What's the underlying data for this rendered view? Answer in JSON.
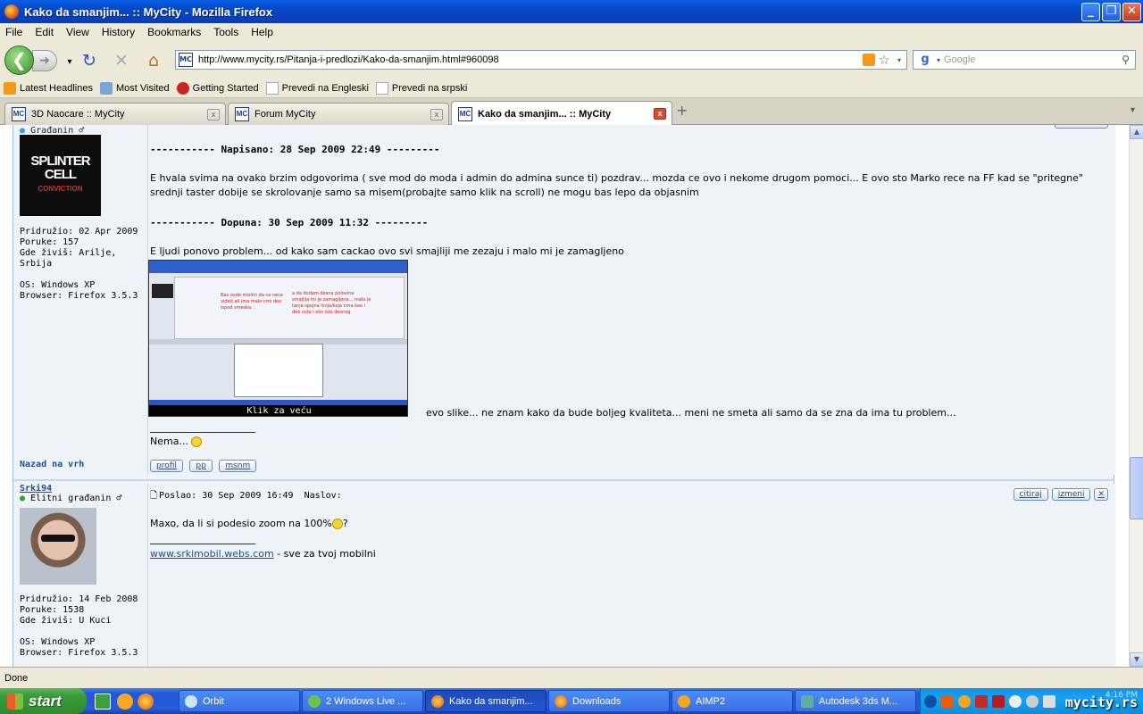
{
  "window": {
    "title": "Kako da smanjim... :: MyCity - Mozilla Firefox"
  },
  "menu": [
    "File",
    "Edit",
    "View",
    "History",
    "Bookmarks",
    "Tools",
    "Help"
  ],
  "nav": {
    "url": "http://www.mycity.rs/Pitanja-i-predlozi/Kako-da-smanjim.html#960098",
    "search_placeholder": "Google"
  },
  "bookmarks": [
    "Latest Headlines",
    "Most Visited",
    "Getting Started",
    "Prevedi na Engleski",
    "Prevedi na srpski"
  ],
  "tabs": [
    {
      "label": "3D Naocare :: MyCity"
    },
    {
      "label": "Forum MyCity"
    },
    {
      "label": "Kako da smanjim... :: MyCity",
      "active": true
    }
  ],
  "post1": {
    "rank": "Građanin ♂",
    "avatar_text": "SPLINTER CELL",
    "avatar_sub": "CONVICTION",
    "joined": "Pridružio: 02 Apr 2009",
    "posts": "Poruke: 157",
    "location": "Gde živiš: Arilje, Srbija",
    "os": "OS: Windows XP",
    "browser": "Browser: Firefox 3.5.3",
    "written_hdr_prefix": "----------- ",
    "written_hdr": "Napisano: 28 Sep 2009 22:49",
    "written_hdr_suffix": " ---------",
    "text1": "E hvala svima na ovako brzim odgovorima ( sve mod do moda i admin do admina sunce ti) pozdrav... mozda ce ovo i nekome drugom pomoci... E ovo sto Marko rece na FF kad se \"pritegne\" srednji taster dobije se skrolovanje samo sa misem(probajte samo klik na scroll) ne mogu bas lepo da objasnim",
    "addition_hdr_prefix": "----------- ",
    "addition_hdr": "Dopuna: 30 Sep 2009 11:32",
    "addition_hdr_suffix": " ---------",
    "text2": "E ljudi ponovo problem... od kako sam cackao ovo svi smajliji me zezaju i malo mi je zamagljeno",
    "image_caption": "Klik za veću",
    "image_note1": "Bas ovde mislim da ce nece videti ali ima malo crni deo ispod smeska...",
    "image_note2": "a da dodam desna polovina smajlija mi je zamagljena... malo je tanja spojna linija/koja crna kao i deo usta i oko isto desnog",
    "after_image": "evo slike... ne znam kako da bude boljeg kvaliteta... meni ne smeta ali samo da se zna da ima tu problem...",
    "signature": "Nema...",
    "back_to_top": "Nazad na vrh",
    "buttons": [
      "profil",
      "pp",
      "msnm"
    ]
  },
  "post2": {
    "username": "Srki94",
    "rank": "Elitni građanin ♂",
    "posted": "Poslao: 30 Sep 2009 16:49",
    "subject_label": "Naslov:",
    "quote_btn": "citiraj",
    "edit_btn": "izmeni",
    "joined": "Pridružio: 14 Feb 2008",
    "posts": "Poruke: 1538",
    "location": "Gde živiš: U Kuci",
    "os": "OS: Windows XP",
    "browser": "Browser: Firefox 3.5.3",
    "text": "Maxo, da li si podesio zoom na 100% ",
    "text_end": "?",
    "sig_link": "www.srkimobil.webs.com",
    "sig_rest": " - sve za tvoj mobilni"
  },
  "status": "Done",
  "taskbar": {
    "start": "start",
    "items": [
      "Orbit",
      "2 Windows Live ...",
      "Kako da smanjim...",
      "Downloads",
      "AIMP2",
      "Autodesk 3ds M..."
    ],
    "watermark": "mycity.rs",
    "clock": "4:16 PM"
  },
  "colors": {
    "accent": "#0a5fe6",
    "forum_bg": "#eef3f8",
    "link": "#1d4f8f"
  }
}
